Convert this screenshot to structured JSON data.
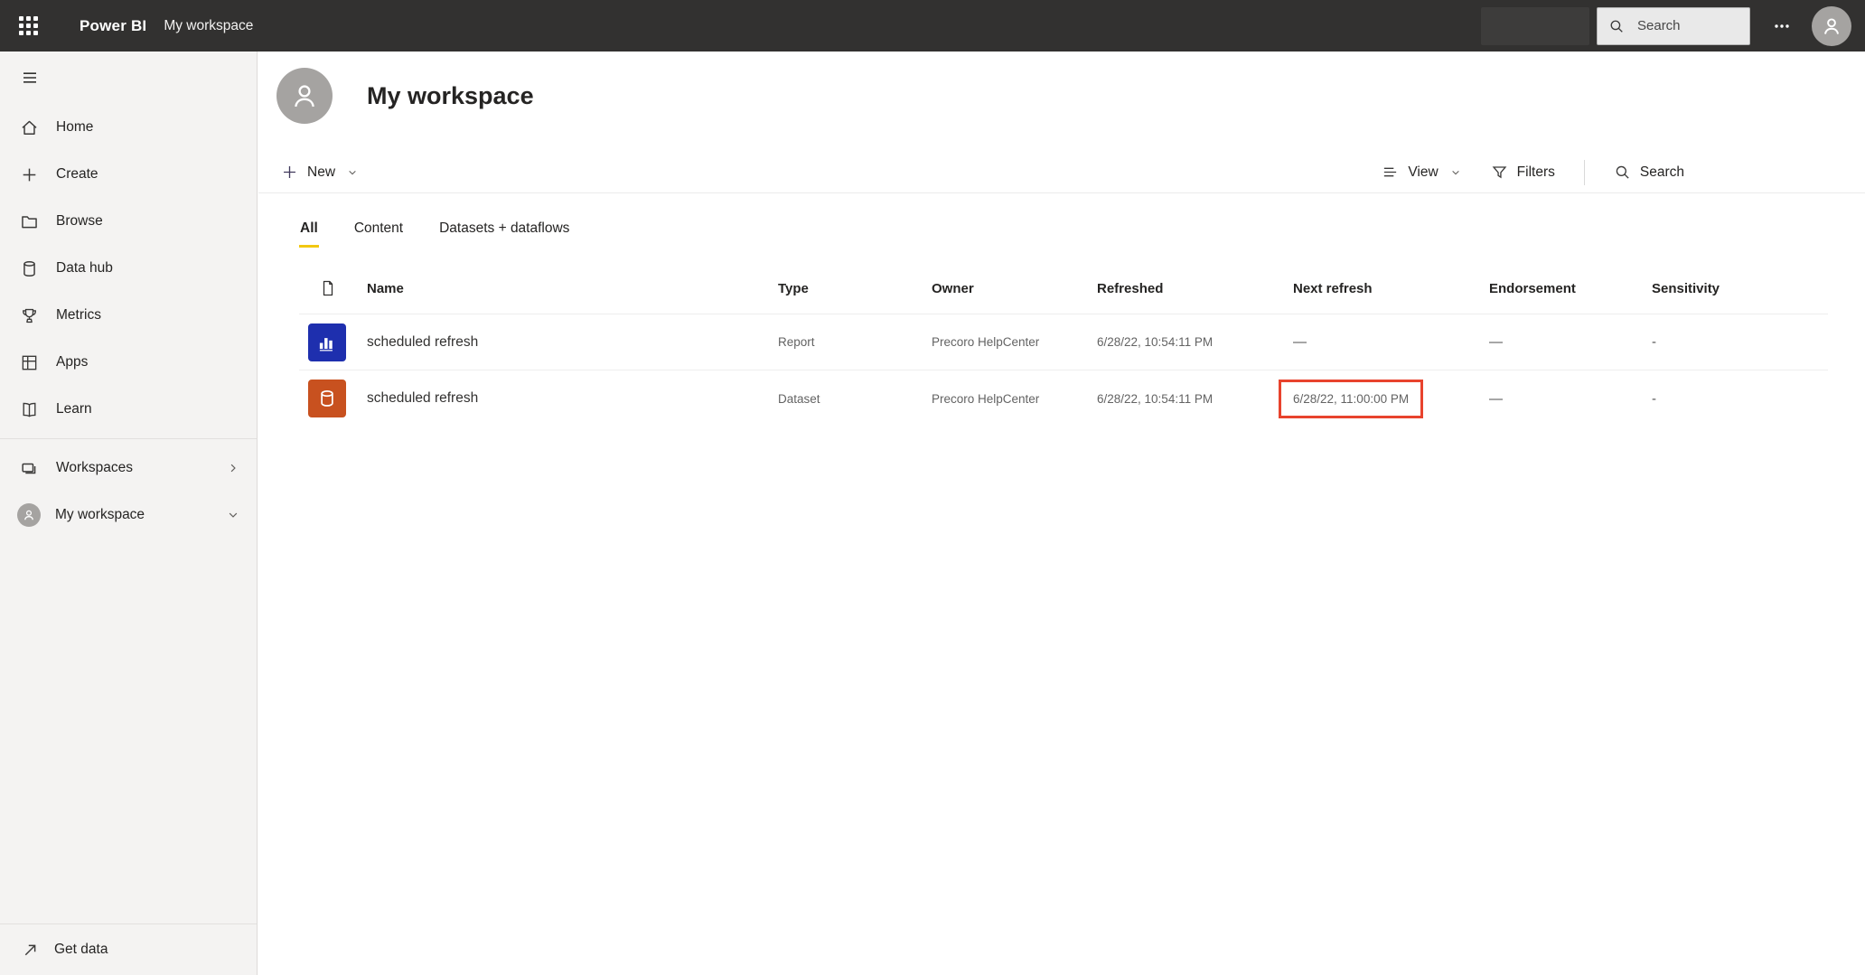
{
  "topbar": {
    "app_name": "Power BI",
    "context": "My workspace",
    "search_placeholder": "Search",
    "more_label": "more-options"
  },
  "sidebar": {
    "items": [
      {
        "label": "Home",
        "icon": "home-icon"
      },
      {
        "label": "Create",
        "icon": "plus-icon"
      },
      {
        "label": "Browse",
        "icon": "folder-icon"
      },
      {
        "label": "Data hub",
        "icon": "database-icon"
      },
      {
        "label": "Metrics",
        "icon": "trophy-icon"
      },
      {
        "label": "Apps",
        "icon": "grid-icon"
      },
      {
        "label": "Learn",
        "icon": "book-icon"
      }
    ],
    "workspaces_label": "Workspaces",
    "my_workspace_label": "My workspace",
    "get_data_label": "Get data"
  },
  "main": {
    "title": "My workspace",
    "toolbar": {
      "new_label": "New",
      "view_label": "View",
      "filters_label": "Filters",
      "search_label": "Search"
    },
    "tabs": [
      {
        "label": "All",
        "active": true
      },
      {
        "label": "Content",
        "active": false
      },
      {
        "label": "Datasets + dataflows",
        "active": false
      }
    ],
    "table": {
      "columns": [
        "Name",
        "Type",
        "Owner",
        "Refreshed",
        "Next refresh",
        "Endorsement",
        "Sensitivity"
      ],
      "rows": [
        {
          "name": "scheduled refresh",
          "type": "Report",
          "owner": "Precoro HelpCenter",
          "refreshed": "6/28/22, 10:54:11 PM",
          "next_refresh": "—",
          "endorsement": "—",
          "sensitivity": "-",
          "icon": "report-icon",
          "icon_color": "#1e2fae",
          "highlight_next_refresh": false
        },
        {
          "name": "scheduled refresh",
          "type": "Dataset",
          "owner": "Precoro HelpCenter",
          "refreshed": "6/28/22, 10:54:11 PM",
          "next_refresh": "6/28/22, 11:00:00 PM",
          "endorsement": "—",
          "sensitivity": "-",
          "icon": "dataset-icon",
          "icon_color": "#c8511f",
          "highlight_next_refresh": true
        }
      ]
    }
  },
  "colors": {
    "topbar_bg": "#323130",
    "accent_yellow": "#f2c811",
    "highlight_red": "#e8432d",
    "report_tile": "#1e2fae",
    "dataset_tile": "#c8511f",
    "avatar_gray": "#a5a3a1"
  }
}
